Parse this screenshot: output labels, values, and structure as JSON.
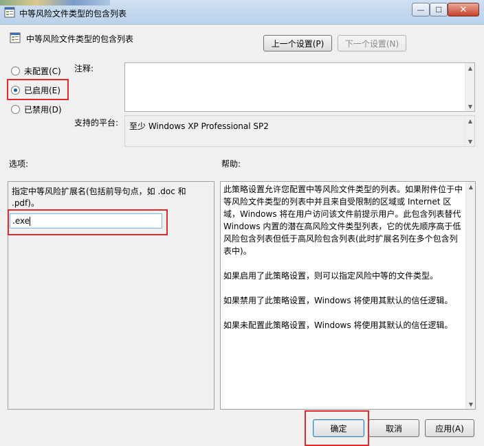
{
  "titlebar": {
    "title": "中等风险文件类型的包含列表",
    "min_glyph": "—",
    "max_glyph": "☐",
    "close_glyph": "✕"
  },
  "header": {
    "title": "中等风险文件类型的包含列表",
    "prev_label": "上一个设置(P)",
    "next_label": "下一个设置(N)"
  },
  "state": {
    "options": [
      {
        "label": "未配置(C)",
        "selected": false
      },
      {
        "label": "已启用(E)",
        "selected": true
      },
      {
        "label": "已禁用(D)",
        "selected": false
      }
    ]
  },
  "comment": {
    "label": "注释:",
    "value": ""
  },
  "platform": {
    "label": "支持的平台:",
    "value": "至少 Windows XP Professional SP2"
  },
  "options_section": {
    "label": "选项:",
    "description": "指定中等风险扩展名(包括前导句点，如 .doc 和 .pdf)。",
    "input_value": ".exe"
  },
  "help_section": {
    "label": "帮助:",
    "paragraphs": [
      "此策略设置允许您配置中等风险文件类型的列表。如果附件位于中等风险文件类型的列表中并且来自受限制的区域或 Internet 区域，Windows 将在用户访问该文件前提示用户。此包含列表替代 Windows 内置的潜在高风险文件类型列表，它的优先顺序高于低风险包含列表但低于高风险包含列表(此时扩展名列在多个包含列表中)。",
      "如果启用了此策略设置，则可以指定风险中等的文件类型。",
      "如果禁用了此策略设置，Windows 将使用其默认的信任逻辑。",
      "如果未配置此策略设置，Windows 将使用其默认的信任逻辑。"
    ]
  },
  "footer": {
    "ok_label": "确定",
    "cancel_label": "取消",
    "apply_label": "应用(A)"
  },
  "colors": {
    "highlight": "#e0292b",
    "accent": "#1b5fa8"
  }
}
